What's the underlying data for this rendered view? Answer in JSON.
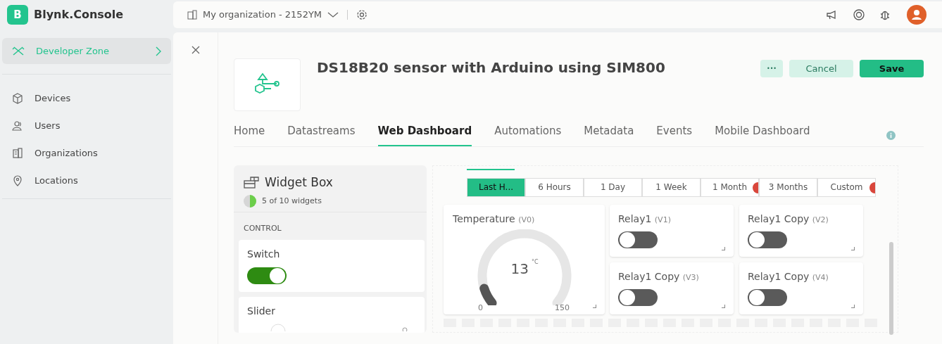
{
  "brand": {
    "logo": "B",
    "name": "Blynk.Console"
  },
  "sidebar": {
    "zone": {
      "label": "Developer Zone",
      "selected": true
    },
    "items": [
      {
        "label": "Devices",
        "kind": "cube"
      },
      {
        "label": "Users",
        "kind": "users"
      },
      {
        "label": "Organizations",
        "kind": "building"
      },
      {
        "label": "Locations",
        "kind": "pin"
      }
    ]
  },
  "topbar": {
    "organization": "My organization - 2152YM"
  },
  "template": {
    "title": "DS18B20 sensor with Arduino using SIM800",
    "buttons": [
      {
        "label": "•••",
        "kind": "more"
      },
      {
        "label": "Cancel",
        "kind": "secondary"
      },
      {
        "label": "Save",
        "kind": "primary"
      }
    ]
  },
  "tabs": [
    {
      "label": "Home",
      "selected": false
    },
    {
      "label": "Datastreams",
      "selected": false
    },
    {
      "label": "Web Dashboard",
      "selected": true
    },
    {
      "label": "Automations",
      "selected": false
    },
    {
      "label": "Metadata",
      "selected": false
    },
    {
      "label": "Events",
      "selected": false
    },
    {
      "label": "Mobile Dashboard",
      "selected": false
    }
  ],
  "widget_box": {
    "title": "Widget Box",
    "count": "5 of 10 widgets",
    "level": 0.5,
    "section": "CONTROL",
    "widgets": [
      {
        "name": "Switch",
        "kind": "switch",
        "on": true
      },
      {
        "name": "Slider",
        "kind": "slider"
      }
    ]
  },
  "time_ranges": [
    {
      "label": "Last H...",
      "selected": true,
      "premium": false
    },
    {
      "label": "6 Hours",
      "selected": false,
      "premium": false
    },
    {
      "label": "1 Day",
      "selected": false,
      "premium": false
    },
    {
      "label": "1 Week",
      "selected": false,
      "premium": false
    },
    {
      "label": "1 Month",
      "selected": false,
      "premium": true
    },
    {
      "label": "3 Months",
      "selected": false,
      "premium": false
    },
    {
      "label": "Custom",
      "selected": false,
      "premium": true
    }
  ],
  "gauge": {
    "title": "Temperature",
    "pin": "(V0)",
    "value": "13",
    "unit": "°C",
    "min": "0",
    "max": "150",
    "level": 0.087
  },
  "relays": [
    {
      "title": "Relay1",
      "pin": "(V1)",
      "on": false
    },
    {
      "title": "Relay1 Copy",
      "pin": "(V2)",
      "on": false
    },
    {
      "title": "Relay1 Copy",
      "pin": "(V3)",
      "on": false
    },
    {
      "title": "Relay1 Copy",
      "pin": "(V4)",
      "on": false
    }
  ]
}
